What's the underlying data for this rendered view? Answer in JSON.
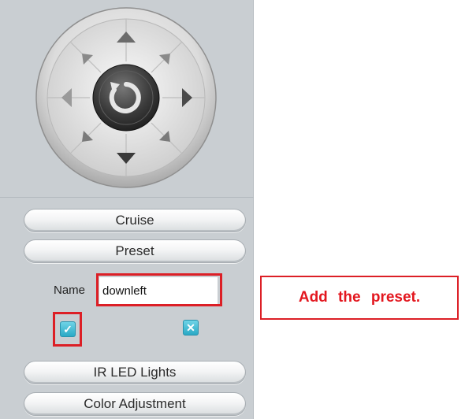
{
  "ptz": {
    "center_icon": "rotate-icon",
    "directions": [
      "up",
      "up-right",
      "right",
      "down-right",
      "down",
      "down-left",
      "left",
      "up-left"
    ]
  },
  "buttons": {
    "cruise": "Cruise",
    "preset": "Preset",
    "ir_led": "IR LED Lights",
    "color_adjustment": "Color Adjustment"
  },
  "preset_form": {
    "name_label": "Name",
    "name_value": "downleft",
    "confirm_icon": "check-icon",
    "cancel_icon": "close-icon"
  },
  "annotation": {
    "text": "Add the preset.",
    "color": "#e3161e"
  }
}
